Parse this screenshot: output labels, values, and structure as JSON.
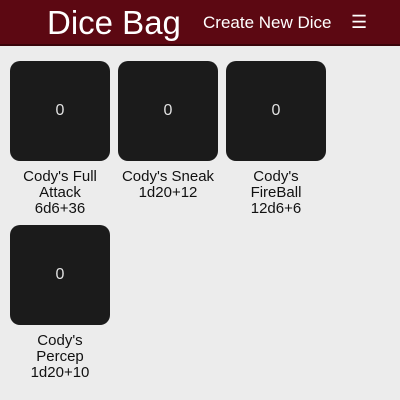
{
  "header": {
    "title": "Dice Bag",
    "create_label": "Create New Dice",
    "menu_icon": "☰"
  },
  "dice": [
    {
      "value": "0",
      "name": "Cody's Full Attack",
      "formula": "6d6+36"
    },
    {
      "value": "0",
      "name": "Cody's Sneak",
      "formula": "1d20+12"
    },
    {
      "value": "0",
      "name": "Cody's FireBall",
      "formula": "12d6+6"
    },
    {
      "value": "0",
      "name": "Cody's Percep",
      "formula": "1d20+10"
    }
  ],
  "colors": {
    "header_bg": "#5c0812",
    "page_bg": "#ececec",
    "dice_bg": "#1b1b1b"
  }
}
